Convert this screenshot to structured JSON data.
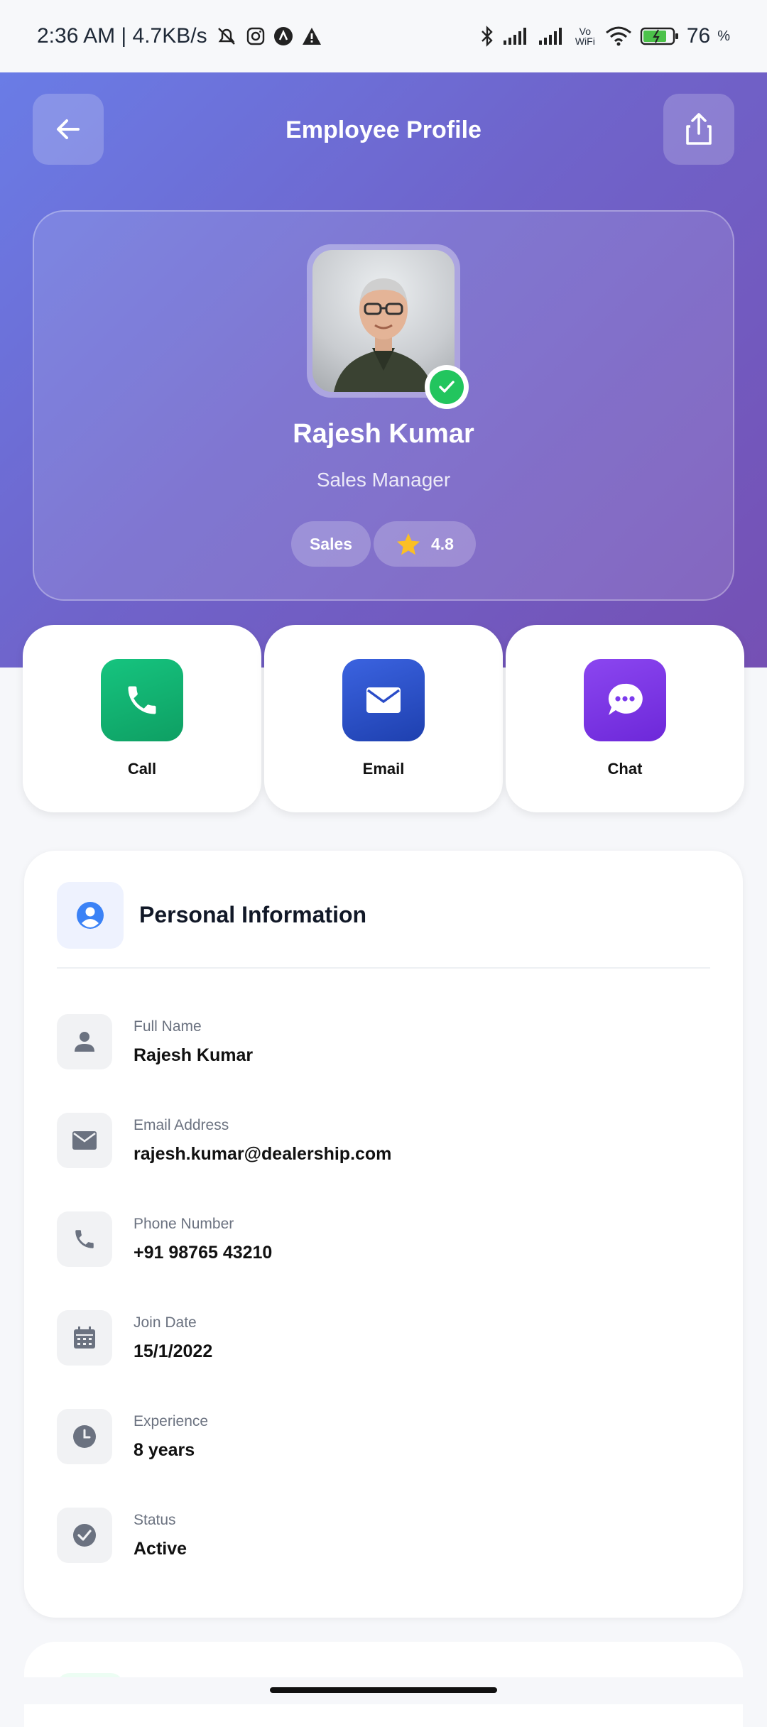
{
  "status_bar": {
    "time_speed": "2:36 AM | 4.7KB/s",
    "vowifi": "Vo WiFi",
    "battery": "76"
  },
  "header": {
    "title": "Employee Profile",
    "back_icon": "arrow-left-icon",
    "share_icon": "share-icon"
  },
  "profile": {
    "name": "Rajesh Kumar",
    "role": "Sales Manager",
    "department": "Sales",
    "rating": "4.8",
    "verified": true
  },
  "actions": [
    {
      "label": "Call",
      "icon": "phone-icon",
      "color": "#12b76a"
    },
    {
      "label": "Email",
      "icon": "mail-icon",
      "color": "#2f55d4"
    },
    {
      "label": "Chat",
      "icon": "chat-icon",
      "color": "#7c3aed"
    }
  ],
  "personal_info": {
    "title": "Personal Information",
    "rows": [
      {
        "label": "Full Name",
        "value": "Rajesh Kumar",
        "icon": "person-icon"
      },
      {
        "label": "Email Address",
        "value": "rajesh.kumar@dealership.com",
        "icon": "mail-icon"
      },
      {
        "label": "Phone Number",
        "value": "+91 98765 43210",
        "icon": "phone-icon"
      },
      {
        "label": "Join Date",
        "value": "15/1/2022",
        "icon": "calendar-icon"
      },
      {
        "label": "Experience",
        "value": "8 years",
        "icon": "clock-icon"
      },
      {
        "label": "Status",
        "value": "Active",
        "icon": "check-circle-icon"
      }
    ]
  }
}
